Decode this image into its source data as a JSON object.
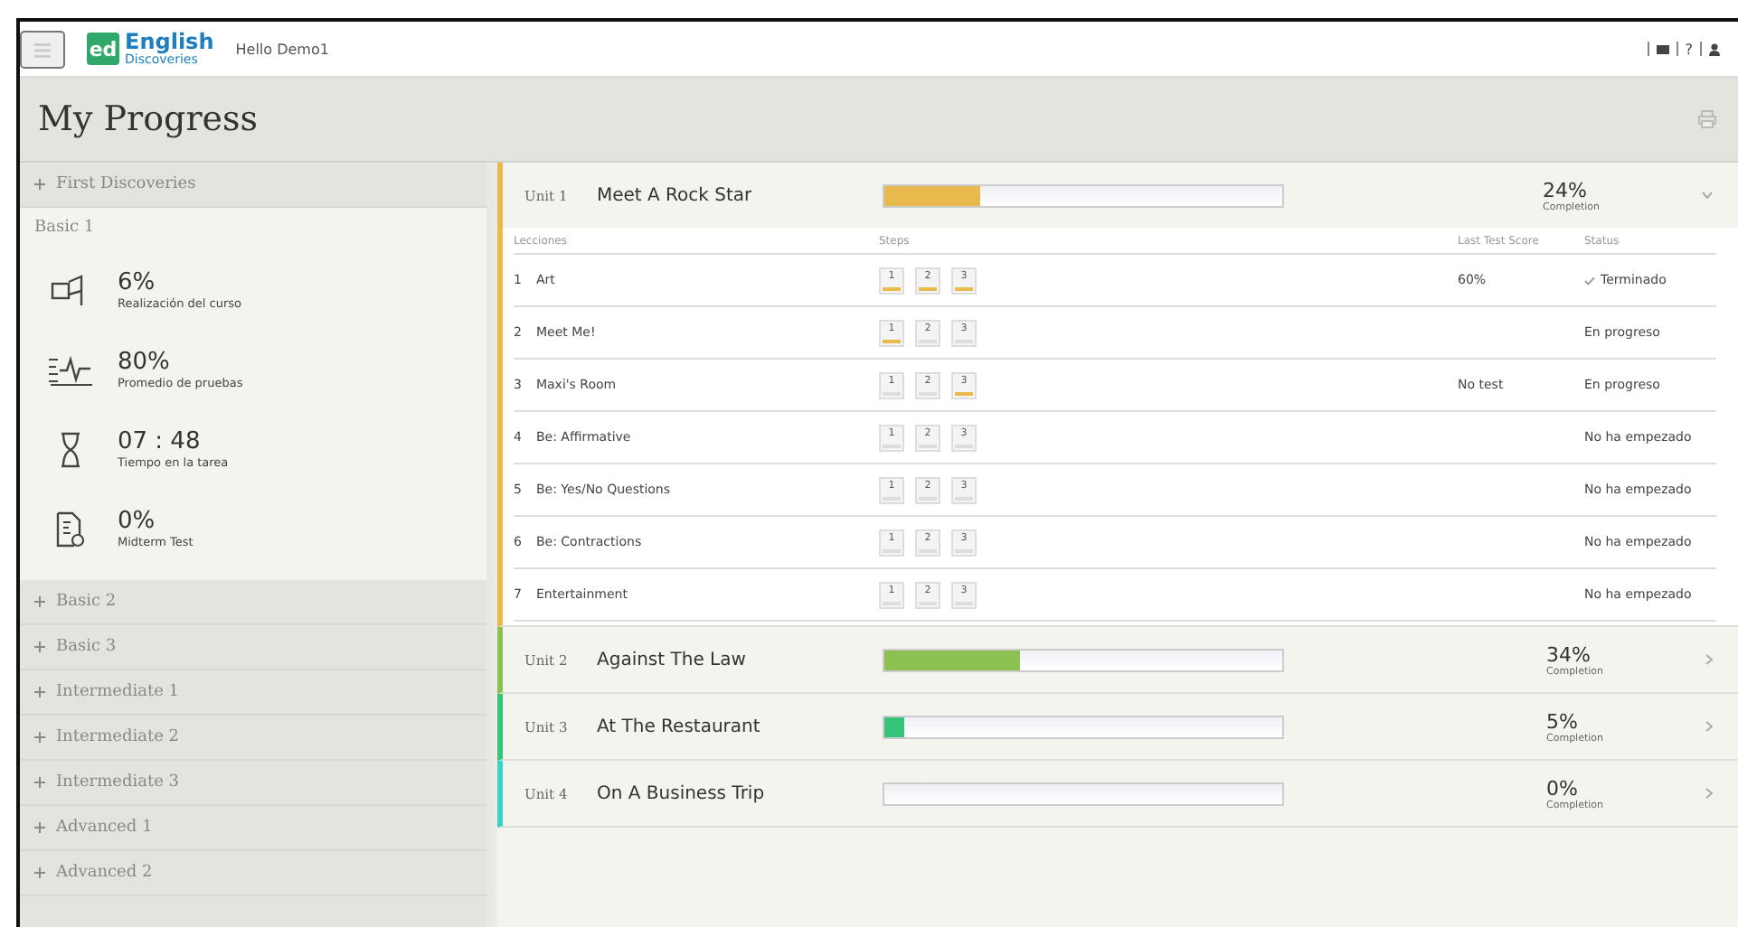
{
  "header": {
    "logo_mark": "ed",
    "logo_title": "English",
    "logo_subtitle": "Discoveries",
    "greeting": "Hello Demo1",
    "help": "?"
  },
  "page_title": "My Progress",
  "sidebar": {
    "levels": [
      {
        "label": "First Discoveries",
        "expanded": false
      },
      {
        "label": "Basic 1",
        "expanded": true,
        "stats": [
          {
            "kind": "course",
            "value": "6%",
            "label": "Realización del curso"
          },
          {
            "kind": "tests",
            "value": "80%",
            "label": "Promedio de pruebas"
          },
          {
            "kind": "time",
            "value": "07 : 48",
            "label": "Tiempo en la tarea"
          },
          {
            "kind": "midterm",
            "value": "0%",
            "label": "Midterm Test"
          }
        ]
      },
      {
        "label": "Basic 2",
        "expanded": false
      },
      {
        "label": "Basic 3",
        "expanded": false
      },
      {
        "label": "Intermediate 1",
        "expanded": false
      },
      {
        "label": "Intermediate 2",
        "expanded": false
      },
      {
        "label": "Intermediate 3",
        "expanded": false
      },
      {
        "label": "Advanced 1",
        "expanded": false
      },
      {
        "label": "Advanced 2",
        "expanded": false
      }
    ]
  },
  "units": [
    {
      "number": "Unit 1",
      "title": "Meet A Rock Star",
      "level": 0.24,
      "percent": "24%",
      "caption": "Completion",
      "color": "#e8b94c",
      "expanded": true,
      "columns": [
        "Lecciones",
        "Steps",
        "Last Test Score",
        "Status"
      ],
      "lessons": [
        {
          "number": "1",
          "title": "Art",
          "steps": [
            {
              "label": "1",
              "done": true
            },
            {
              "label": "2",
              "done": true
            },
            {
              "label": "3",
              "done": true
            }
          ],
          "score": "60%",
          "status": "Terminado",
          "complete": true
        },
        {
          "number": "2",
          "title": "Meet Me!",
          "steps": [
            {
              "label": "1",
              "done": true
            },
            {
              "label": "2",
              "done": false
            },
            {
              "label": "3",
              "done": false
            }
          ],
          "status": "En progreso",
          "complete": false
        },
        {
          "number": "3",
          "title": "Maxi's Room",
          "steps": [
            {
              "label": "1",
              "done": false
            },
            {
              "label": "2",
              "done": false
            },
            {
              "label": "3",
              "done": true
            }
          ],
          "score": "No test",
          "status": "En progreso",
          "complete": false
        },
        {
          "number": "4",
          "title": "Be: Affirmative",
          "steps": [
            {
              "label": "1",
              "done": false
            },
            {
              "label": "2",
              "done": false
            },
            {
              "label": "3",
              "done": false
            }
          ],
          "status": "No ha empezado",
          "complete": false
        },
        {
          "number": "5",
          "title": "Be: Yes/No Questions",
          "steps": [
            {
              "label": "1",
              "done": false
            },
            {
              "label": "2",
              "done": false
            },
            {
              "label": "3",
              "done": false
            }
          ],
          "status": "No ha empezado",
          "complete": false
        },
        {
          "number": "6",
          "title": "Be: Contractions",
          "steps": [
            {
              "label": "1",
              "done": false
            },
            {
              "label": "2",
              "done": false
            },
            {
              "label": "3",
              "done": false
            }
          ],
          "status": "No ha empezado",
          "complete": false
        },
        {
          "number": "7",
          "title": "Entertainment",
          "steps": [
            {
              "label": "1",
              "done": false
            },
            {
              "label": "2",
              "done": false
            },
            {
              "label": "3",
              "done": false
            }
          ],
          "status": "No ha empezado",
          "complete": false
        }
      ]
    },
    {
      "number": "Unit 2",
      "title": "Against The Law",
      "level": 0.34,
      "percent": "34%",
      "caption": "Completion",
      "color": "#8cc152",
      "expanded": false
    },
    {
      "number": "Unit 3",
      "title": "At The Restaurant",
      "level": 0.05,
      "percent": "5%",
      "caption": "Completion",
      "color": "#37c47a",
      "expanded": false
    },
    {
      "number": "Unit 4",
      "title": "On A Business Trip",
      "level": 0,
      "percent": "0%",
      "caption": "Completion",
      "color": "#3ccfc4",
      "expanded": false
    }
  ]
}
